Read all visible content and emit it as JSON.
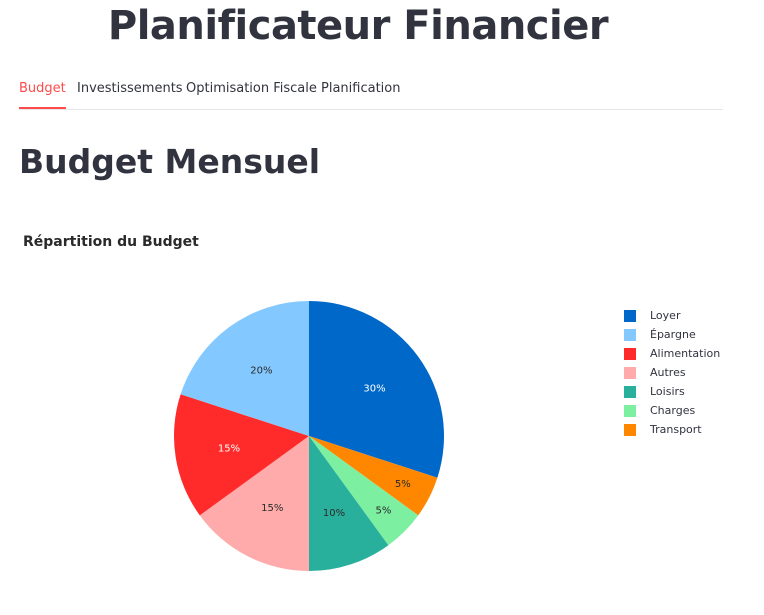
{
  "app": {
    "title": "Planificateur Financier"
  },
  "tabs": [
    {
      "label": "Budget",
      "active": true
    },
    {
      "label": "Investissements",
      "active": false
    },
    {
      "label": "Optimisation Fiscale",
      "active": false
    },
    {
      "label": "Planification",
      "active": false
    }
  ],
  "section": {
    "title": "Budget Mensuel"
  },
  "chart_data": {
    "type": "pie",
    "title": "Répartition du Budget",
    "categories": [
      "Loyer",
      "Épargne",
      "Alimentation",
      "Autres",
      "Loisirs",
      "Charges",
      "Transport"
    ],
    "values": [
      30,
      20,
      15,
      15,
      10,
      5,
      5
    ],
    "labels": [
      "30%",
      "20%",
      "15%",
      "15%",
      "10%",
      "5%",
      "5%"
    ],
    "colors": [
      "#0068c9",
      "#83c9ff",
      "#ff2b2b",
      "#ffabab",
      "#29b09d",
      "#7defa1",
      "#ff8700"
    ],
    "direction": "counterclockwise",
    "legend_position": "right"
  }
}
